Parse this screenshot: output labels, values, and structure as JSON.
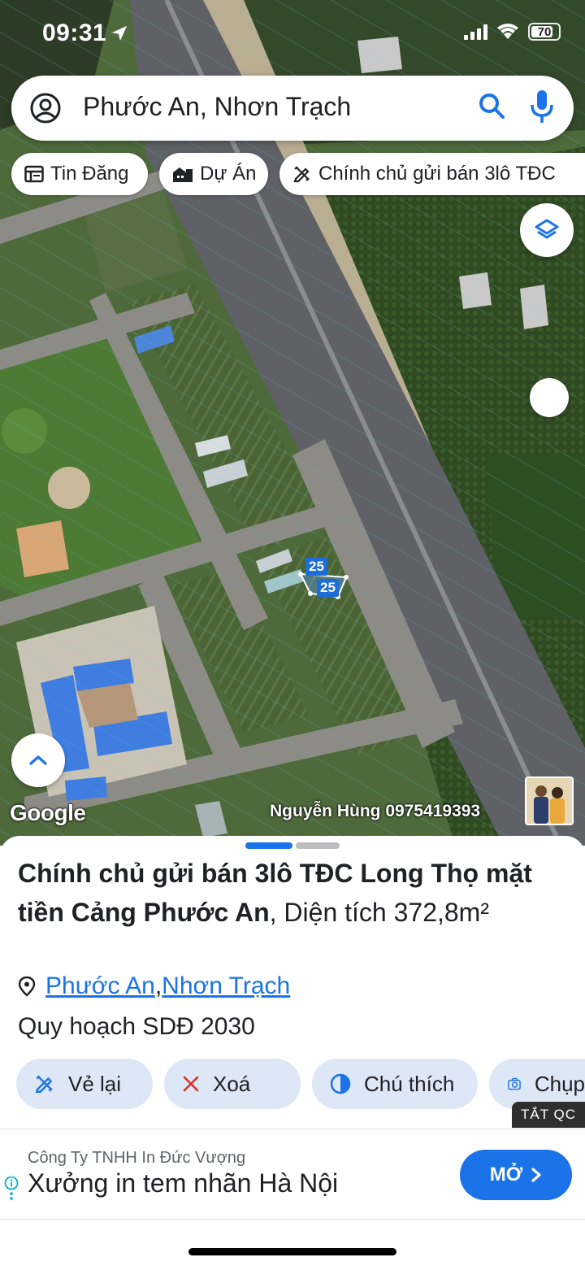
{
  "status_bar": {
    "time": "09:31",
    "battery": "70"
  },
  "search": {
    "query": "Phước An, Nhơn Trạch"
  },
  "chips": [
    {
      "label": "Tin Đăng",
      "icon": "newspaper-icon"
    },
    {
      "label": "Dự Án",
      "icon": "building-icon"
    },
    {
      "label": "Chính chủ gửi bán 3lô TĐC",
      "icon": "edit-tools-icon"
    }
  ],
  "map": {
    "parcel_labels": [
      "25",
      "25"
    ],
    "google_logo": "Google",
    "watermark": "Nguyễn Hùng 0975419393"
  },
  "listing": {
    "title_bold": "Chính chủ gửi bán 3lô TĐC Long Thọ mặt tiền Cảng Phước An",
    "title_rest": ", Diện tích 372,8m²",
    "location_ward": "Phước An",
    "location_sep": ", ",
    "location_district": "Nhơn Trạch",
    "plan": "Quy hoạch SDĐ 2030",
    "actions": [
      {
        "label": "Vẻ lại"
      },
      {
        "label": "Xoá"
      },
      {
        "label": "Chú thích"
      },
      {
        "label": "Chụp"
      }
    ]
  },
  "ad_toggle": "TẮT QC",
  "ad": {
    "company": "Công Ty TNHH In Đức Vượng",
    "headline": "Xưởng in tem nhãn Hà Nội",
    "button": "MỞ"
  },
  "colors": {
    "accent": "#1a73e8",
    "action_bg": "#dde7f6"
  }
}
